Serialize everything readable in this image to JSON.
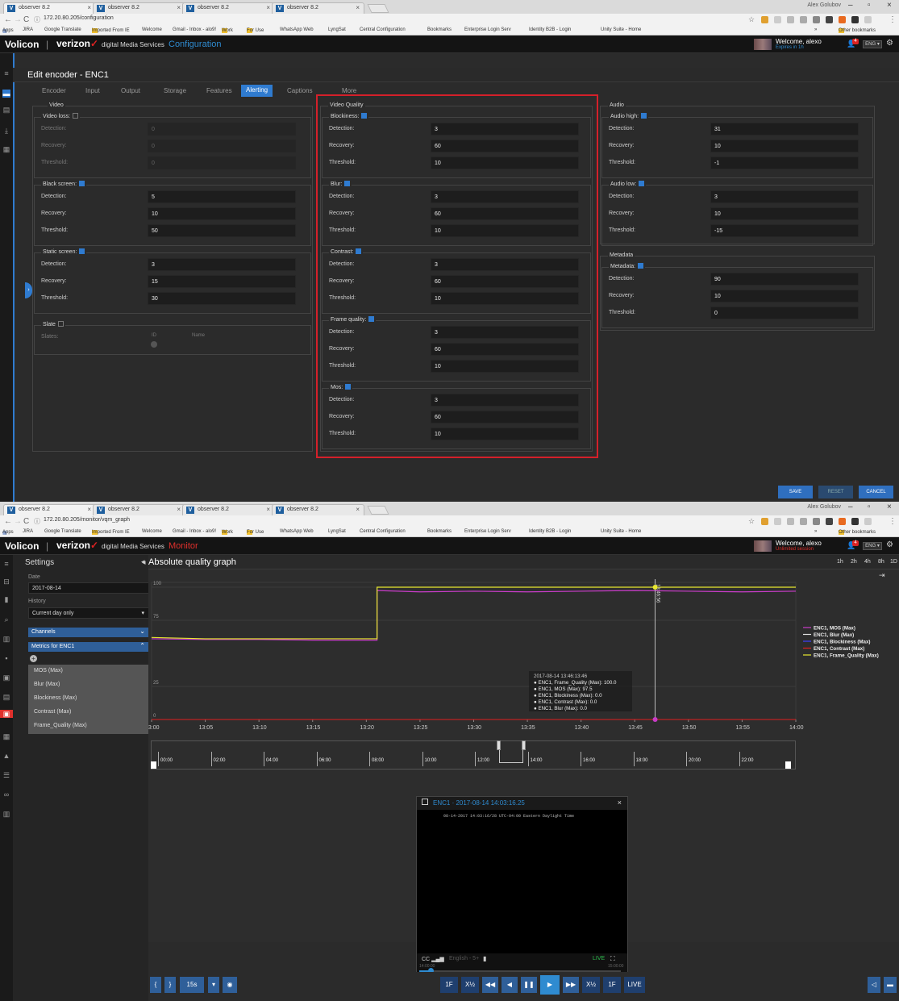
{
  "windows": [
    {
      "tabs": [
        {
          "title": "observer 8.2"
        },
        {
          "title": "observer 8.2"
        },
        {
          "title": "observer 8.2"
        },
        {
          "title": "observer 8.2"
        }
      ],
      "win_user": "Alex Golubov",
      "url": "172.20.80.205/configuration",
      "mode": "Configuration",
      "welcome": "Welcome, alexo",
      "session": "Expires in 1h"
    },
    {
      "tabs": [
        {
          "title": "observer 8.2"
        },
        {
          "title": "observer 8.2"
        },
        {
          "title": "observer 8.2"
        },
        {
          "title": "observer 8.2"
        }
      ],
      "win_user": "Alex Golubov",
      "url": "172.20.80.205/monitor/vqm_graph",
      "mode": "Monitor",
      "welcome": "Welcome, alexo",
      "session": "Unlimited session"
    }
  ],
  "browser": {
    "bookmarks": [
      "Apps",
      "JIRA",
      "Google Translate",
      "Imported From IE",
      "Welcome",
      "Gmail - Inbox - alo9!",
      "Work",
      "For Use",
      "WhatsApp Web",
      "LyngSat",
      "Central Configuration",
      "Bookmarks",
      "Enterprise Login Serv",
      "Identity B2B - Login",
      "Unity Suite - Home",
      "»",
      "Other bookmarks"
    ]
  },
  "app": {
    "logo": "Volicon",
    "brand": "verizon",
    "brand_sub": "digital Media Services",
    "notif_count": "4",
    "lang": "ENG",
    "colors": {
      "config": "#2f8bd0",
      "monitor": "#e0302c",
      "accent": "#2f7bd0",
      "redbox": "#d4202a"
    }
  },
  "config": {
    "title": "Edit encoder - ENC1",
    "tabs": [
      "Encoder",
      "Input",
      "Output",
      "Storage",
      "Features",
      "Alerting",
      "Captions",
      "More"
    ],
    "active_tab": "Alerting",
    "labels": {
      "detection": "Detection:",
      "recovery": "Recovery:",
      "threshold": "Threshold:"
    },
    "video": {
      "title": "Video",
      "video_loss": {
        "title": "Video loss:",
        "checked": false,
        "detection": "0",
        "recovery": "0",
        "threshold": "0"
      },
      "black_screen": {
        "title": "Black screen:",
        "checked": true,
        "detection": "5",
        "recovery": "10",
        "threshold": "50"
      },
      "static_screen": {
        "title": "Static screen:",
        "checked": true,
        "detection": "3",
        "recovery": "15",
        "threshold": "30"
      },
      "slate": {
        "title": "Slate",
        "checked": false,
        "slates_label": "Slates:",
        "id_col": "ID",
        "name_col": "Name"
      }
    },
    "video_quality": {
      "title": "Video Quality",
      "blockiness": {
        "title": "Blockiness:",
        "checked": true,
        "detection": "3",
        "recovery": "60",
        "threshold": "10"
      },
      "blur": {
        "title": "Blur:",
        "checked": true,
        "detection": "3",
        "recovery": "60",
        "threshold": "10"
      },
      "contrast": {
        "title": "Contrast:",
        "checked": true,
        "detection": "3",
        "recovery": "60",
        "threshold": "10"
      },
      "frame_quality": {
        "title": "Frame quality:",
        "checked": true,
        "detection": "3",
        "recovery": "60",
        "threshold": "10"
      },
      "mos": {
        "title": "Mos:",
        "checked": true,
        "detection": "3",
        "recovery": "60",
        "threshold": "10"
      }
    },
    "audio": {
      "title": "Audio",
      "audio_high": {
        "title": "Audio high:",
        "checked": true,
        "detection": "31",
        "recovery": "10",
        "threshold": "-1"
      },
      "audio_low": {
        "title": "Audio low:",
        "checked": true,
        "detection": "3",
        "recovery": "10",
        "threshold": "-15"
      }
    },
    "metadata": {
      "title": "Metadata",
      "metadata": {
        "title": "Metadata:",
        "checked": true,
        "detection": "90",
        "recovery": "10",
        "threshold": "0"
      }
    },
    "buttons": {
      "save": "SAVE",
      "reset": "RESET",
      "cancel": "CANCEL"
    }
  },
  "monitor": {
    "settings_title": "Settings",
    "date_label": "Date",
    "date": "2017-08-14",
    "history_label": "History",
    "history": "Current day only",
    "channels": "Channels",
    "metrics_for": "Metrics for ENC1",
    "metrics": [
      "MOS (Max)",
      "Blur (Max)",
      "Blockiness (Max)",
      "Contrast (Max)",
      "Frame_Quality (Max)"
    ],
    "graph_title": "Absolute quality graph",
    "ranges": [
      "1h",
      "2h",
      "4h",
      "8h",
      "1D"
    ],
    "tooltip": [
      "2017-08-14 13:46:13:46",
      "● ENC1, Frame_Quality (Max): 100.0",
      "● ENC1, MOS (Max): 97.5",
      "● ENC1, Blockiness (Max): 0.0",
      "● ENC1, Contrast (Max): 0.0",
      "● ENC1, Blur (Max): 0.0"
    ],
    "cursor_label": "13:46:56",
    "timeline_ticks": [
      "00:00",
      "02:00",
      "04:00",
      "06:00",
      "08:00",
      "10:00",
      "12:00",
      "14:00",
      "16:00",
      "18:00",
      "20:00",
      "22:00"
    ],
    "video": {
      "title": "ENC1 · 2017-08-14 14:03:16.25",
      "subtitle": "08-14-2017 14:03:16/28 UTC-04:00 Eastern Daylight Time",
      "cc": "CC",
      "audio": "English - 5+",
      "live": "LIVE",
      "t_start": "14:00:00",
      "t_end": "15:00:00"
    },
    "transport": {
      "speed": "15s",
      "step_back": "1F",
      "slow_back": "X½",
      "slow_fwd": "X½",
      "step_fwd": "1F",
      "live": "LIVE"
    }
  },
  "chart_data": {
    "type": "line",
    "x_unit": "time (hh:mm)",
    "xlim": [
      "13:00",
      "14:00"
    ],
    "ylim": [
      0,
      100
    ],
    "y_ticks": [
      0,
      25,
      75,
      100
    ],
    "x_ticks": [
      "13:00",
      "13:05",
      "13:10",
      "13:15",
      "13:20",
      "13:25",
      "13:30",
      "13:35",
      "13:40",
      "13:45",
      "13:50",
      "13:55",
      "14:00"
    ],
    "grid": true,
    "legend": "right",
    "x": [
      "13:00",
      "13:05",
      "13:10",
      "13:15",
      "13:20",
      "13:21",
      "13:25",
      "13:30",
      "13:35",
      "13:40",
      "13:45",
      "13:50",
      "13:55",
      "14:00"
    ],
    "series": [
      {
        "name": "ENC1, MOS (Max)",
        "color": "#c83cc8",
        "values": [
          61,
          60.5,
          60.5,
          60,
          60,
          97.5,
          96.5,
          97,
          96.5,
          97,
          97.5,
          97,
          96.5,
          97
        ]
      },
      {
        "name": "ENC1, Blur (Max)",
        "color": "#e0e0e0",
        "values": [
          0,
          0,
          0,
          0,
          0,
          0,
          0,
          0,
          0,
          0,
          0,
          0,
          0,
          0
        ]
      },
      {
        "name": "ENC1, Blockiness (Max)",
        "color": "#4040ff",
        "values": [
          0,
          0,
          0,
          0,
          0,
          0,
          0,
          0,
          0,
          0,
          0,
          0,
          0,
          0
        ]
      },
      {
        "name": "ENC1, Contrast (Max)",
        "color": "#e02020",
        "values": [
          0,
          0,
          0,
          0,
          0,
          0,
          0,
          0,
          0,
          0,
          0,
          0,
          0,
          0
        ]
      },
      {
        "name": "ENC1, Frame_Quality (Max)",
        "color": "#e8e830",
        "values": [
          62,
          61,
          61,
          61,
          61,
          100,
          100,
          100,
          100,
          100,
          100,
          100,
          100,
          100
        ]
      }
    ]
  }
}
